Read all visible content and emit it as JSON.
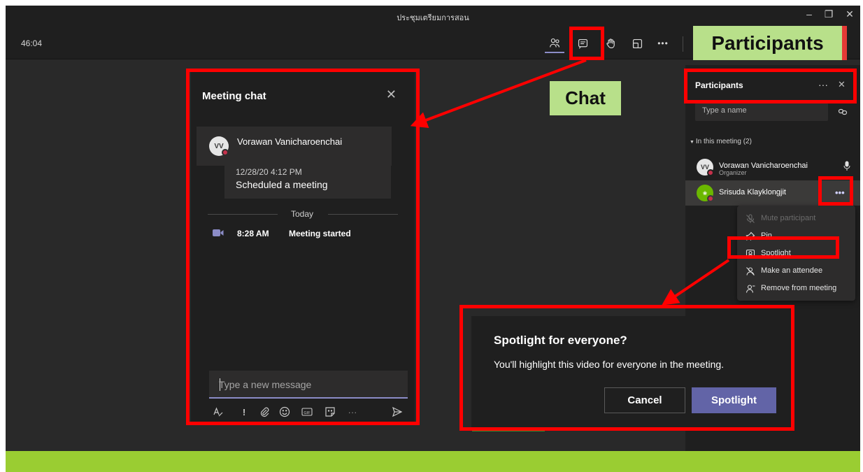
{
  "window": {
    "title": "ประชุมเตรียมการสอน",
    "minimize": "–",
    "restore": "❐",
    "close": "✕"
  },
  "toolbar": {
    "timer": "46:04",
    "more": "•••"
  },
  "chat": {
    "title": "Meeting chat",
    "close": "✕",
    "sender_initials": "VV",
    "sender_name": "Vorawan Vanicharoenchai",
    "meeting_timestamp": "12/28/20 4:12 PM",
    "meeting_text": "Scheduled a meeting",
    "divider_label": "Today",
    "event_time": "8:28 AM",
    "event_text": "Meeting started",
    "composer_placeholder": "Type a new message",
    "tools": [
      "format",
      "important",
      "attach",
      "emoji",
      "gif",
      "sticker",
      "more",
      "send"
    ],
    "important_glyph": "!",
    "more_glyph": "···"
  },
  "participants": {
    "title": "Participants",
    "more": "···",
    "close": "✕",
    "search_placeholder": "Type a name",
    "section_label": "In this meeting (2)",
    "people": [
      {
        "initials": "VV",
        "name": "Vorawan Vanicharoenchai",
        "role": "Organizer"
      },
      {
        "initials": "",
        "name": "Srisuda Klayklongjit",
        "role": "",
        "more": "•••"
      }
    ]
  },
  "context_menu": {
    "items": [
      {
        "label": "Mute participant",
        "icon": "mic-off-icon",
        "enabled": false
      },
      {
        "label": "Pin",
        "icon": "pin-icon",
        "enabled": true
      },
      {
        "label": "Spotlight",
        "icon": "spotlight-icon",
        "enabled": true
      },
      {
        "label": "Make an attendee",
        "icon": "person-off-icon",
        "enabled": true
      },
      {
        "label": "Remove from meeting",
        "icon": "remove-person-icon",
        "enabled": true
      }
    ]
  },
  "dialog": {
    "title": "Spotlight for everyone?",
    "body": "You'll highlight this video for everyone in the meeting.",
    "cancel": "Cancel",
    "confirm": "Spotlight"
  },
  "annotations": {
    "participants_callout": "Participants",
    "chat_callout": "Chat"
  },
  "colors": {
    "accent": "#6264a7",
    "annotation_red": "#ff0000",
    "callout_green": "#b8e08a",
    "footer_green": "#9acd32"
  }
}
